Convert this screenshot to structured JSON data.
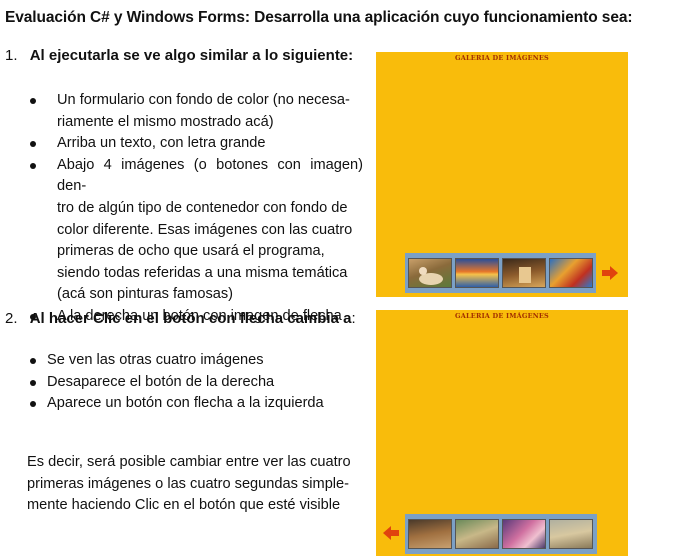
{
  "title": "Evaluación C# y Windows Forms: Desarrolla una aplicación cuyo funcionamiento sea:",
  "section1": {
    "num": "1.",
    "heading": "Al ejecutarla se ve algo similar a lo siguiente:",
    "bullets": [
      [
        "Un formulario con fondo de color (no necesa-",
        "riamente el mismo mostrado acá)"
      ],
      [
        "Arriba un texto, con letra grande"
      ],
      [
        "Abajo 4 imágenes (o botones con imagen) den-",
        "tro de algún tipo de contenedor con fondo de",
        "color diferente. Esas imágenes con las cuatro",
        "primeras de ocho que usará el programa,",
        "siendo todas referidas a una misma temática",
        "(acá son pinturas famosas)"
      ],
      [
        "A la derecha un botón con imagen de flecha"
      ]
    ]
  },
  "section2": {
    "num": "2.",
    "heading_bold": "Al hacer Clic en el botón con flecha cambia a",
    "heading_tail": ":",
    "bullets": [
      "Se ven las otras cuatro imágenes",
      "Desaparece el botón de la derecha",
      "Aparece un botón con flecha a la izquierda"
    ],
    "para": [
      "Es decir, será posible cambiar entre ver las cuatro",
      "primeras imágenes o las cuatro segundas simple-",
      "mente haciendo Clic en el botón que esté visible"
    ]
  },
  "gallery": {
    "title": "GALERIA DE IMÁGENES",
    "bg": "#f9bc0b",
    "strip_bg": "#7ba0c6",
    "arrow_color": "#e0440e"
  }
}
